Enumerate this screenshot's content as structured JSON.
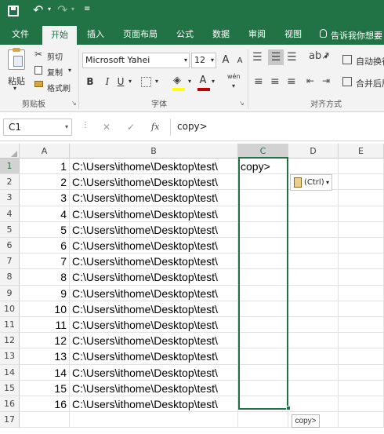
{
  "title_bar": {
    "quick_access": [
      "save-icon",
      "undo-icon",
      "redo-icon",
      "customize-icon"
    ]
  },
  "tabs": [
    {
      "label": "文件",
      "active": false
    },
    {
      "label": "开始",
      "active": true
    },
    {
      "label": "插入",
      "active": false
    },
    {
      "label": "页面布局",
      "active": false
    },
    {
      "label": "公式",
      "active": false
    },
    {
      "label": "数据",
      "active": false
    },
    {
      "label": "审阅",
      "active": false
    },
    {
      "label": "视图",
      "active": false
    }
  ],
  "tell_me": "告诉我你想要",
  "ribbon": {
    "clipboard": {
      "paste": "粘贴",
      "cut": "剪切",
      "copy": "复制",
      "format_painter": "格式刷",
      "group": "剪贴板"
    },
    "font": {
      "name": "Microsoft Yahei",
      "size": "12",
      "group": "字体",
      "bold": "B",
      "italic": "I",
      "underline": "U",
      "grow": "A",
      "shrink": "A",
      "fill_color": "#ffff00",
      "font_color": "#c00000",
      "phonetic": "wén"
    },
    "alignment": {
      "wrap": "自动换行",
      "merge": "合并后居",
      "group": "对齐方式"
    }
  },
  "formula_bar": {
    "name_box": "C1",
    "cancel": "✕",
    "enter": "✓",
    "fx": "fx",
    "content": "copy>"
  },
  "columns": [
    "A",
    "B",
    "C",
    "D",
    "E"
  ],
  "selected_column": "C",
  "rows": [
    {
      "n": "1",
      "a": "1",
      "b": "C:\\Users\\ithome\\Desktop\\test\\",
      "c": "copy>"
    },
    {
      "n": "2",
      "a": "2",
      "b": "C:\\Users\\ithome\\Desktop\\test\\",
      "c": ""
    },
    {
      "n": "3",
      "a": "3",
      "b": "C:\\Users\\ithome\\Desktop\\test\\",
      "c": ""
    },
    {
      "n": "4",
      "a": "4",
      "b": "C:\\Users\\ithome\\Desktop\\test\\",
      "c": ""
    },
    {
      "n": "5",
      "a": "5",
      "b": "C:\\Users\\ithome\\Desktop\\test\\",
      "c": ""
    },
    {
      "n": "6",
      "a": "6",
      "b": "C:\\Users\\ithome\\Desktop\\test\\",
      "c": ""
    },
    {
      "n": "7",
      "a": "7",
      "b": "C:\\Users\\ithome\\Desktop\\test\\",
      "c": ""
    },
    {
      "n": "8",
      "a": "8",
      "b": "C:\\Users\\ithome\\Desktop\\test\\",
      "c": ""
    },
    {
      "n": "9",
      "a": "9",
      "b": "C:\\Users\\ithome\\Desktop\\test\\",
      "c": ""
    },
    {
      "n": "10",
      "a": "10",
      "b": "C:\\Users\\ithome\\Desktop\\test\\",
      "c": ""
    },
    {
      "n": "11",
      "a": "11",
      "b": "C:\\Users\\ithome\\Desktop\\test\\",
      "c": ""
    },
    {
      "n": "12",
      "a": "12",
      "b": "C:\\Users\\ithome\\Desktop\\test\\",
      "c": ""
    },
    {
      "n": "13",
      "a": "13",
      "b": "C:\\Users\\ithome\\Desktop\\test\\",
      "c": ""
    },
    {
      "n": "14",
      "a": "14",
      "b": "C:\\Users\\ithome\\Desktop\\test\\",
      "c": ""
    },
    {
      "n": "15",
      "a": "15",
      "b": "C:\\Users\\ithome\\Desktop\\test\\",
      "c": ""
    },
    {
      "n": "16",
      "a": "16",
      "b": "C:\\Users\\ithome\\Desktop\\test\\",
      "c": ""
    },
    {
      "n": "17",
      "a": "",
      "b": "",
      "c": ""
    }
  ],
  "paste_options": {
    "label": "(Ctrl)"
  },
  "autofill_tooltip": "copy>",
  "colors": {
    "accent": "#217346",
    "ribbon_bg": "#f3f3f3"
  }
}
